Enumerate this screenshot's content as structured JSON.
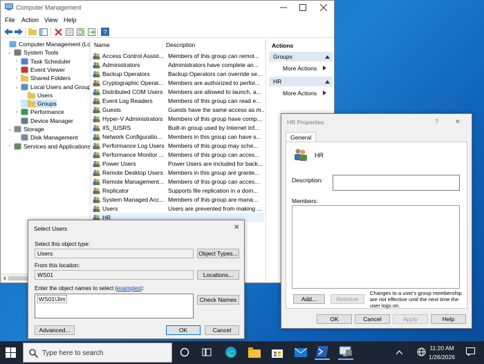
{
  "cm": {
    "title": "Computer Management",
    "menu": [
      "File",
      "Action",
      "View",
      "Help"
    ],
    "tree": [
      {
        "label": "Computer Management (Local",
        "indent": 0,
        "chev": "",
        "icon": "computer"
      },
      {
        "label": "System Tools",
        "indent": 1,
        "chev": "⌄",
        "icon": "tools"
      },
      {
        "label": "Task Scheduler",
        "indent": 2,
        "chev": "›",
        "icon": "clock"
      },
      {
        "label": "Event Viewer",
        "indent": 2,
        "chev": "›",
        "icon": "event"
      },
      {
        "label": "Shared Folders",
        "indent": 2,
        "chev": "›",
        "icon": "folder"
      },
      {
        "label": "Local Users and Groups",
        "indent": 2,
        "chev": "⌄",
        "icon": "users"
      },
      {
        "label": "Users",
        "indent": 3,
        "chev": "",
        "icon": "folder"
      },
      {
        "label": "Groups",
        "indent": 3,
        "chev": "",
        "icon": "folder",
        "selected": true
      },
      {
        "label": "Performance",
        "indent": 2,
        "chev": "›",
        "icon": "perf"
      },
      {
        "label": "Device Manager",
        "indent": 2,
        "chev": "",
        "icon": "device"
      },
      {
        "label": "Storage",
        "indent": 1,
        "chev": "⌄",
        "icon": "storage"
      },
      {
        "label": "Disk Management",
        "indent": 2,
        "chev": "",
        "icon": "disk"
      },
      {
        "label": "Services and Applications",
        "indent": 1,
        "chev": "›",
        "icon": "services"
      }
    ],
    "columns": {
      "name": "Name",
      "description": "Description"
    },
    "groups": [
      {
        "name": "Access Control Assist...",
        "desc": "Members of this group can remot..."
      },
      {
        "name": "Administrators",
        "desc": "Administrators have complete an..."
      },
      {
        "name": "Backup Operators",
        "desc": "Backup Operators can override se..."
      },
      {
        "name": "Cryptographic Operat...",
        "desc": "Members are authorized to perfor..."
      },
      {
        "name": "Distributed COM Users",
        "desc": "Members are allowed to launch, a..."
      },
      {
        "name": "Event Log Readers",
        "desc": "Members of this group can read e..."
      },
      {
        "name": "Guests",
        "desc": "Guests have the same access as m..."
      },
      {
        "name": "Hyper-V Administrators",
        "desc": "Members of this group have comp..."
      },
      {
        "name": "IIS_IUSRS",
        "desc": "Built-in group used by Internet Inf..."
      },
      {
        "name": "Network Configuratio...",
        "desc": "Members in this group can have s..."
      },
      {
        "name": "Performance Log Users",
        "desc": "Members of this group may sche..."
      },
      {
        "name": "Performance Monitor ...",
        "desc": "Members of this group can acces..."
      },
      {
        "name": "Power Users",
        "desc": "Power Users are included for back..."
      },
      {
        "name": "Remote Desktop Users",
        "desc": "Members in this group are grante..."
      },
      {
        "name": "Remote Management...",
        "desc": "Members of this group can acces..."
      },
      {
        "name": "Replicator",
        "desc": "Supports file replication in a dom..."
      },
      {
        "name": "System Managed Acc...",
        "desc": "Members of this group are mana..."
      },
      {
        "name": "Users",
        "desc": "Users are prevented from making ..."
      },
      {
        "name": "HR",
        "desc": "",
        "selected": true
      }
    ],
    "actions": {
      "header": "Actions",
      "sections": [
        {
          "title": "Groups",
          "item": "More Actions"
        },
        {
          "title": "HR",
          "item": "More Actions"
        }
      ]
    }
  },
  "hr_props": {
    "title": "HR Properties",
    "help": "?",
    "close": "✕",
    "tab": "General",
    "group_name": "HR",
    "description_label": "Description:",
    "description_value": "",
    "members_label": "Members:",
    "add_label": "Add...",
    "remove_label": "Remove",
    "note": "Changes to a user's group membership are not effective until the next time the user logs on.",
    "ok": "OK",
    "cancel": "Cancel",
    "apply": "Apply",
    "helpbtn": "Help"
  },
  "select_users": {
    "title": "Select Users",
    "close": "✕",
    "type_label": "Select this object type:",
    "type_value": "Users",
    "object_types_btn": "Object Types...",
    "location_label": "From this location:",
    "location_value": "WS01",
    "locations_btn": "Locations...",
    "names_label_prefix": "Enter the object names to select (",
    "names_label_link": "examples",
    "names_label_suffix": "):",
    "names_value": "WS01\\Jim",
    "check_names_btn": "Check Names",
    "advanced_btn": "Advanced...",
    "ok": "OK",
    "cancel": "Cancel"
  },
  "taskbar": {
    "search_placeholder": "Type here to search",
    "time": "11:20 AM",
    "date": "1/26/2026"
  }
}
